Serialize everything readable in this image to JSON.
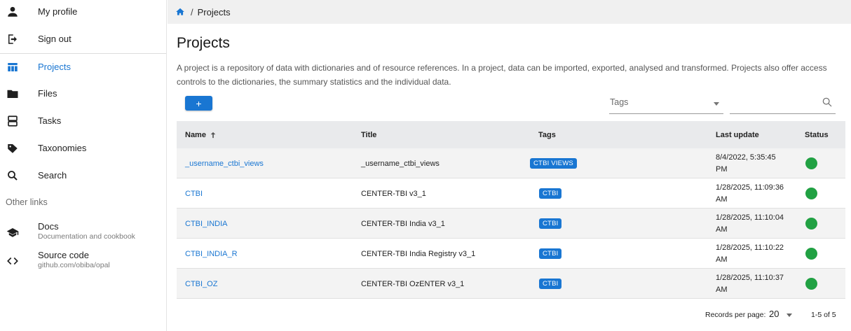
{
  "sidebar": {
    "items": [
      {
        "label": "My profile",
        "icon": "person-icon"
      },
      {
        "label": "Sign out",
        "icon": "logout-icon"
      },
      {
        "label": "Projects",
        "icon": "table-icon",
        "active": true
      },
      {
        "label": "Files",
        "icon": "folder-icon"
      },
      {
        "label": "Tasks",
        "icon": "tasks-icon"
      },
      {
        "label": "Taxonomies",
        "icon": "tag-icon"
      },
      {
        "label": "Search",
        "icon": "search-icon"
      }
    ],
    "other_links_header": "Other links",
    "links": [
      {
        "title": "Docs",
        "caption": "Documentation and cookbook",
        "icon": "school-icon"
      },
      {
        "title": "Source code",
        "caption": "github.com/obiba/opal",
        "icon": "code-icon"
      }
    ]
  },
  "breadcrumb": {
    "separator": "/",
    "current": "Projects"
  },
  "main": {
    "title": "Projects",
    "description": "A project is a repository of data with dictionaries and of resource references. In a project, data can be imported, exported, analysed and transformed. Projects also offer access controls to the dictionaries, the summary statistics and the individual data.",
    "add_label": "+",
    "tags_placeholder": "Tags",
    "search_value": ""
  },
  "table": {
    "columns": [
      "Name",
      "Title",
      "Tags",
      "Last update",
      "Status"
    ],
    "sort_indicator": "↑",
    "rows": [
      {
        "name": "_username_ctbi_views",
        "title": "_username_ctbi_views",
        "tag": "CTBI VIEWS",
        "updated": "8/4/2022, 5:35:45 PM",
        "status": "online"
      },
      {
        "name": "CTBI",
        "title": "CENTER-TBI v3_1",
        "tag": "CTBI",
        "updated": "1/28/2025, 11:09:36 AM",
        "status": "online"
      },
      {
        "name": "CTBI_INDIA",
        "title": "CENTER-TBI India v3_1",
        "tag": "CTBI",
        "updated": "1/28/2025, 11:10:04 AM",
        "status": "online"
      },
      {
        "name": "CTBI_INDIA_R",
        "title": "CENTER-TBI India Registry v3_1",
        "tag": "CTBI",
        "updated": "1/28/2025, 11:10:22 AM",
        "status": "online"
      },
      {
        "name": "CTBI_OZ",
        "title": "CENTER-TBI OzENTER v3_1",
        "tag": "CTBI",
        "updated": "1/28/2025, 11:10:37 AM",
        "status": "online"
      }
    ]
  },
  "pagination": {
    "rows_per_page_label": "Records per page:",
    "rows_per_page": "20",
    "range": "1-5 of 5"
  },
  "colors": {
    "accent": "#1976d2",
    "status_ok": "#21a143",
    "header_bg": "#e9eaec"
  }
}
